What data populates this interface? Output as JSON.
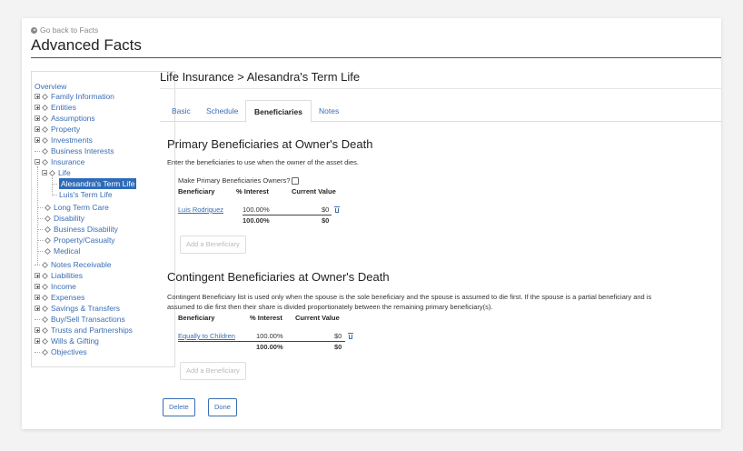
{
  "header": {
    "back_link": "Go back to Facts",
    "title": "Advanced Facts"
  },
  "sidebar": {
    "overview": "Overview",
    "family_information": "Family Information",
    "entities": "Entities",
    "assumptions": "Assumptions",
    "property": "Property",
    "investments": "Investments",
    "business_interests": "Business Interests",
    "insurance": "Insurance",
    "life": "Life",
    "alesandra_term_life": "Alesandra's Term Life",
    "luis_term_life": "Luis's Term Life",
    "long_term_care": "Long Term Care",
    "disability": "Disability",
    "business_disability": "Business Disability",
    "property_casualty": "Property/Casualty",
    "medical": "Medical",
    "notes_receivable": "Notes Receivable",
    "liabilities": "Liabilities",
    "income": "Income",
    "expenses": "Expenses",
    "savings_transfers": "Savings & Transfers",
    "buy_sell": "Buy/Sell Transactions",
    "trusts": "Trusts and Partnerships",
    "wills": "Wills & Gifting",
    "objectives": "Objectives"
  },
  "main": {
    "title": "Life Insurance > Alesandra's Term Life",
    "tabs": [
      "Basic",
      "Schedule",
      "Beneficiaries",
      "Notes"
    ],
    "active_tab": "Beneficiaries"
  },
  "primary": {
    "heading": "Primary Beneficiaries at Owner's Death",
    "description": "Enter the beneficiaries to use when the owner of the asset dies.",
    "owners_checkbox_label": "Make Primary Beneficiaries Owners?",
    "columns": [
      "Beneficiary",
      "% Interest",
      "Current Value"
    ],
    "rows": [
      {
        "name": "Luis Rodriguez",
        "interest": "100.00%",
        "value": "$0"
      }
    ],
    "total_interest": "100.00%",
    "total_value": "$0",
    "add_button": "Add a Beneficiary"
  },
  "contingent": {
    "heading": "Contingent Beneficiaries at Owner's Death",
    "description_line1": "Contingent Beneficiary list is used only when the spouse is the sole beneficiary and the spouse is assumed to die first. If the spouse is a partial beneficiary and is",
    "description_line2": "assumed to die first then their share is divided proportionately between the remaining primary beneficiary(s).",
    "columns": [
      "Beneficiary",
      "% Interest",
      "Current Value"
    ],
    "rows": [
      {
        "name": "Equally to Children",
        "interest": "100.00%",
        "value": "$0"
      }
    ],
    "total_interest": "100.00%",
    "total_value": "$0",
    "add_button": "Add a Beneficiary"
  },
  "footer": {
    "delete_button": "Delete",
    "done_button": "Done"
  },
  "colors": {
    "link": "#3a6db5",
    "selected_bg": "#2f6bb8",
    "heading": "#222222"
  }
}
